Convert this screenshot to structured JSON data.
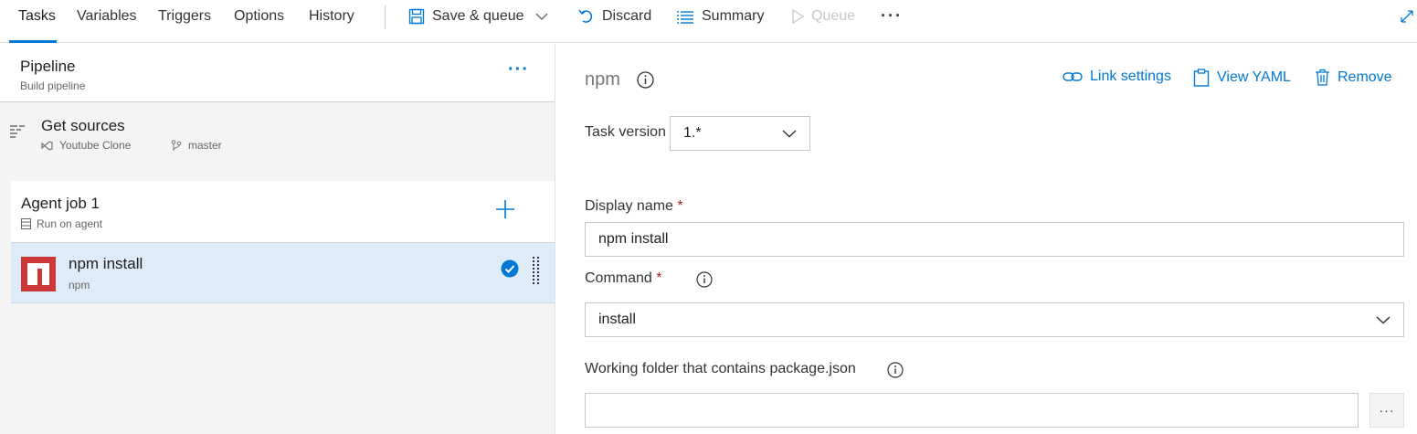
{
  "tabs": [
    {
      "label": "Tasks",
      "active": true
    },
    {
      "label": "Variables"
    },
    {
      "label": "Triggers"
    },
    {
      "label": "Options"
    },
    {
      "label": "History"
    }
  ],
  "toolbar": {
    "save_queue": "Save & queue",
    "discard": "Discard",
    "summary": "Summary",
    "queue": "Queue",
    "more": "···"
  },
  "pipeline": {
    "title": "Pipeline",
    "subtitle": "Build pipeline",
    "more": "···"
  },
  "get_sources": {
    "title": "Get sources",
    "repo": "Youtube Clone",
    "branch": "master"
  },
  "agent_job": {
    "title": "Agent job 1",
    "subtitle": "Run on agent"
  },
  "task": {
    "title": "npm install",
    "subtitle": "npm"
  },
  "detail": {
    "title": "npm",
    "link_settings": "Link settings",
    "view_yaml": "View YAML",
    "remove": "Remove",
    "task_version_label": "Task version",
    "task_version_value": "1.*",
    "display_name_label": "Display name",
    "display_name_value": "npm install",
    "command_label": "Command",
    "command_value": "install",
    "working_folder_label": "Working folder that contains package.json",
    "working_folder_value": "",
    "browse": "···",
    "required_marker": "*"
  },
  "colors": {
    "accent": "#0078d4",
    "selected_row": "#deecf9",
    "npm_red": "#cb3837",
    "required": "#a4262c"
  }
}
